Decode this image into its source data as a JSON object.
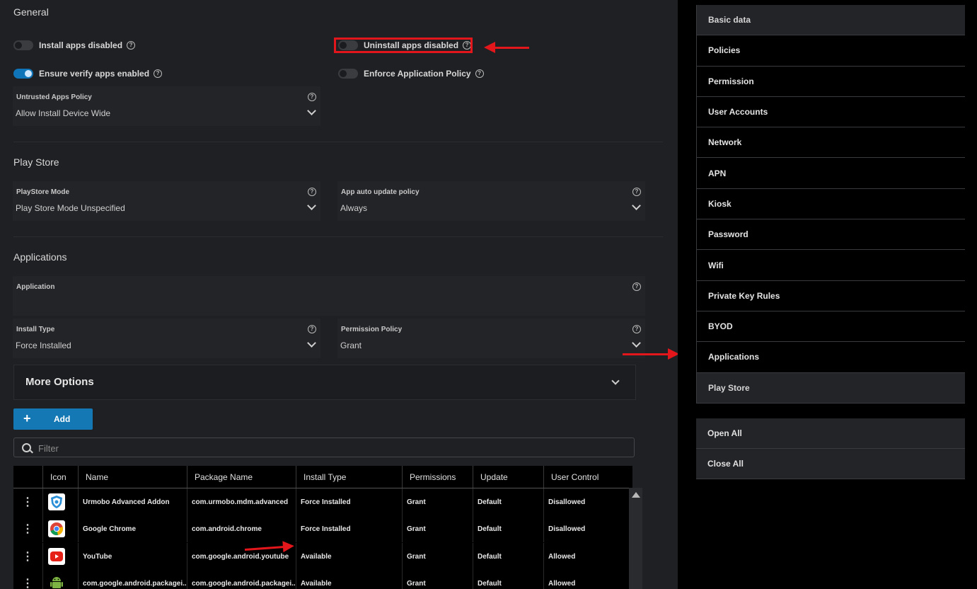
{
  "general": {
    "title": "General",
    "install_apps_disabled": {
      "label": "Install apps disabled",
      "on": false
    },
    "uninstall_apps_disabled": {
      "label": "Uninstall apps disabled",
      "on": false
    },
    "ensure_verify_apps": {
      "label": "Ensure verify apps enabled",
      "on": true
    },
    "enforce_app_policy": {
      "label": "Enforce Application Policy",
      "on": false
    },
    "untrusted_apps_policy": {
      "label": "Untrusted Apps Policy",
      "value": "Allow Install Device Wide"
    }
  },
  "play_store": {
    "title": "Play Store",
    "mode": {
      "label": "PlayStore Mode",
      "value": "Play Store Mode Unspecified"
    },
    "auto_update": {
      "label": "App auto update policy",
      "value": "Always"
    }
  },
  "applications": {
    "title": "Applications",
    "application": {
      "label": "Application",
      "value": ""
    },
    "install_type": {
      "label": "Install Type",
      "value": "Force Installed"
    },
    "permission_policy": {
      "label": "Permission Policy",
      "value": "Grant"
    },
    "more_options": "More Options",
    "add_label": "Add",
    "filter_placeholder": "Filter"
  },
  "table": {
    "headers": [
      "Icon",
      "Name",
      "Package Name",
      "Install Type",
      "Permissions",
      "Update",
      "User Control"
    ],
    "rows": [
      {
        "icon": "urmobo-shield-icon",
        "name": "Urmobo Advanced Addon",
        "package": "com.urmobo.mdm.advanced",
        "install_type": "Force Installed",
        "permissions": "Grant",
        "update": "Default",
        "user_control": "Disallowed"
      },
      {
        "icon": "chrome-icon",
        "name": "Google Chrome",
        "package": "com.android.chrome",
        "install_type": "Force Installed",
        "permissions": "Grant",
        "update": "Default",
        "user_control": "Disallowed"
      },
      {
        "icon": "youtube-icon",
        "name": "YouTube",
        "package": "com.google.android.youtube",
        "install_type": "Available",
        "permissions": "Grant",
        "update": "Default",
        "user_control": "Allowed"
      },
      {
        "icon": "android-icon",
        "name": "com.google.android.packagei...",
        "package": "com.google.android.packagei...",
        "install_type": "Available",
        "permissions": "Grant",
        "update": "Default",
        "user_control": "Allowed"
      }
    ]
  },
  "sidebar": {
    "items": [
      {
        "label": "Basic data"
      },
      {
        "label": "Policies"
      },
      {
        "label": "Permission"
      },
      {
        "label": "User Accounts"
      },
      {
        "label": "Network"
      },
      {
        "label": "APN"
      },
      {
        "label": "Kiosk"
      },
      {
        "label": "Password"
      },
      {
        "label": "Wifi"
      },
      {
        "label": "Private Key Rules"
      },
      {
        "label": "BYOD"
      },
      {
        "label": "Applications"
      },
      {
        "label": "Play Store"
      }
    ],
    "open_all": "Open All",
    "close_all": "Close All"
  },
  "colors": {
    "accent": "#1478b4",
    "annotation": "#e3161b",
    "background": "#1f2023"
  }
}
